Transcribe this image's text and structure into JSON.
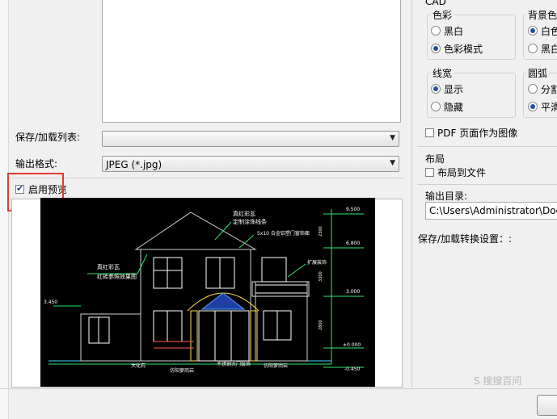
{
  "left": {
    "save_load_list_label": "保存/加载列表:",
    "output_format_label": "输出格式:",
    "output_format_value": "JPEG (*.jpg)",
    "enable_preview_label": "启用预览"
  },
  "right": {
    "cad_label": "CAD",
    "color_group": {
      "title": "色彩",
      "options": [
        "黑白",
        "色彩模式"
      ]
    },
    "bg_group": {
      "title": "背景色",
      "options": [
        "白色",
        "黑白"
      ]
    },
    "linewidth_group": {
      "title": "线宽",
      "options": [
        "显示",
        "隐藏"
      ]
    },
    "arc_group": {
      "title": "圆弧",
      "options": [
        "分割",
        "平滑"
      ]
    },
    "pdf_as_image_label": "PDF 页面作为图像",
    "layout_label": "布局",
    "layout_to_file_label": "布局到文件",
    "output_dir_label": "输出目录:",
    "output_dir_value": "C:\\Users\\Administrator\\Docum",
    "save_load_convert_label": "保存/加载转换设置：:"
  },
  "drawing": {
    "labels": [
      "9.500",
      "6.800",
      "3.000",
      "±0.000",
      "-0.450",
      "3.450",
      "2800",
      "3300",
      "2300",
      "真红彩瓦",
      "定制涂饰线条",
      "5x10 合金铝塑门窗饰面",
      "真红彩瓦",
      "红砖参照效果图",
      "扩展装饰",
      "大化石",
      "仿阳萝岗岩",
      "不锈钢大门装饰",
      "仿阳萝岗岩"
    ]
  },
  "watermark": "S 搜搜百问",
  "colors": {
    "accent": "#1f4fa3",
    "highlight": "#e23a2f",
    "cad_bg": "#000000"
  }
}
